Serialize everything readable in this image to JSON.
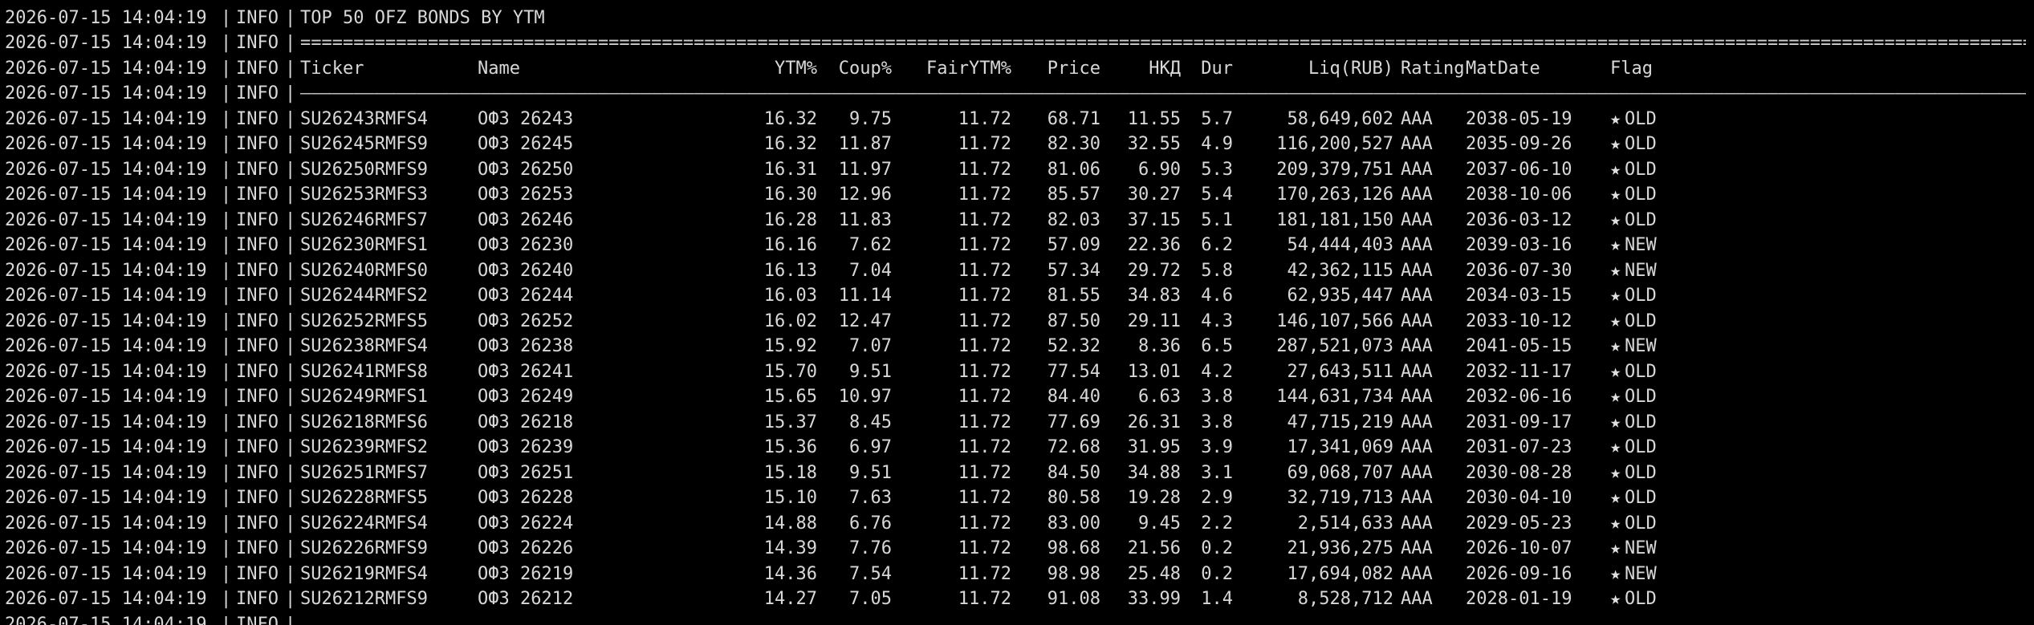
{
  "log": {
    "timestamp": "2026-07-15 14:04:19",
    "level": "INFO",
    "separator": "|",
    "title": "TOP 50 OFZ BONDS BY YTM"
  },
  "table": {
    "headers": {
      "ticker": "Ticker",
      "name": "Name",
      "ytm": "YTM%",
      "coupon": "Coup%",
      "fair_ytm": "FairYTM%",
      "price": "Price",
      "nkd": "НКД",
      "duration": "Dur",
      "liquidity": "Liq(RUB)",
      "rating": "Rating",
      "maturity": "MatDate",
      "flag": "Flag"
    },
    "rows": [
      {
        "ticker": "SU26243RMFS4",
        "name": "ОФЗ 26243",
        "ytm": "16.32",
        "coupon": "9.75",
        "fair_ytm": "11.72",
        "price": "68.71",
        "nkd": "11.55",
        "duration": "5.7",
        "liquidity": "58,649,602",
        "rating": "AAA",
        "maturity": "2038-05-19",
        "flag_icon": "★",
        "flag": "OLD"
      },
      {
        "ticker": "SU26245RMFS9",
        "name": "ОФЗ 26245",
        "ytm": "16.32",
        "coupon": "11.87",
        "fair_ytm": "11.72",
        "price": "82.30",
        "nkd": "32.55",
        "duration": "4.9",
        "liquidity": "116,200,527",
        "rating": "AAA",
        "maturity": "2035-09-26",
        "flag_icon": "★",
        "flag": "OLD"
      },
      {
        "ticker": "SU26250RMFS9",
        "name": "ОФЗ 26250",
        "ytm": "16.31",
        "coupon": "11.97",
        "fair_ytm": "11.72",
        "price": "81.06",
        "nkd": "6.90",
        "duration": "5.3",
        "liquidity": "209,379,751",
        "rating": "AAA",
        "maturity": "2037-06-10",
        "flag_icon": "★",
        "flag": "OLD"
      },
      {
        "ticker": "SU26253RMFS3",
        "name": "ОФЗ 26253",
        "ytm": "16.30",
        "coupon": "12.96",
        "fair_ytm": "11.72",
        "price": "85.57",
        "nkd": "30.27",
        "duration": "5.4",
        "liquidity": "170,263,126",
        "rating": "AAA",
        "maturity": "2038-10-06",
        "flag_icon": "★",
        "flag": "OLD"
      },
      {
        "ticker": "SU26246RMFS7",
        "name": "ОФЗ 26246",
        "ytm": "16.28",
        "coupon": "11.83",
        "fair_ytm": "11.72",
        "price": "82.03",
        "nkd": "37.15",
        "duration": "5.1",
        "liquidity": "181,181,150",
        "rating": "AAA",
        "maturity": "2036-03-12",
        "flag_icon": "★",
        "flag": "OLD"
      },
      {
        "ticker": "SU26230RMFS1",
        "name": "ОФЗ 26230",
        "ytm": "16.16",
        "coupon": "7.62",
        "fair_ytm": "11.72",
        "price": "57.09",
        "nkd": "22.36",
        "duration": "6.2",
        "liquidity": "54,444,403",
        "rating": "AAA",
        "maturity": "2039-03-16",
        "flag_icon": "★",
        "flag": "NEW"
      },
      {
        "ticker": "SU26240RMFS0",
        "name": "ОФЗ 26240",
        "ytm": "16.13",
        "coupon": "7.04",
        "fair_ytm": "11.72",
        "price": "57.34",
        "nkd": "29.72",
        "duration": "5.8",
        "liquidity": "42,362,115",
        "rating": "AAA",
        "maturity": "2036-07-30",
        "flag_icon": "★",
        "flag": "NEW"
      },
      {
        "ticker": "SU26244RMFS2",
        "name": "ОФЗ 26244",
        "ytm": "16.03",
        "coupon": "11.14",
        "fair_ytm": "11.72",
        "price": "81.55",
        "nkd": "34.83",
        "duration": "4.6",
        "liquidity": "62,935,447",
        "rating": "AAA",
        "maturity": "2034-03-15",
        "flag_icon": "★",
        "flag": "OLD"
      },
      {
        "ticker": "SU26252RMFS5",
        "name": "ОФЗ 26252",
        "ytm": "16.02",
        "coupon": "12.47",
        "fair_ytm": "11.72",
        "price": "87.50",
        "nkd": "29.11",
        "duration": "4.3",
        "liquidity": "146,107,566",
        "rating": "AAA",
        "maturity": "2033-10-12",
        "flag_icon": "★",
        "flag": "OLD"
      },
      {
        "ticker": "SU26238RMFS4",
        "name": "ОФЗ 26238",
        "ytm": "15.92",
        "coupon": "7.07",
        "fair_ytm": "11.72",
        "price": "52.32",
        "nkd": "8.36",
        "duration": "6.5",
        "liquidity": "287,521,073",
        "rating": "AAA",
        "maturity": "2041-05-15",
        "flag_icon": "★",
        "flag": "NEW"
      },
      {
        "ticker": "SU26241RMFS8",
        "name": "ОФЗ 26241",
        "ytm": "15.70",
        "coupon": "9.51",
        "fair_ytm": "11.72",
        "price": "77.54",
        "nkd": "13.01",
        "duration": "4.2",
        "liquidity": "27,643,511",
        "rating": "AAA",
        "maturity": "2032-11-17",
        "flag_icon": "★",
        "flag": "OLD"
      },
      {
        "ticker": "SU26249RMFS1",
        "name": "ОФЗ 26249",
        "ytm": "15.65",
        "coupon": "10.97",
        "fair_ytm": "11.72",
        "price": "84.40",
        "nkd": "6.63",
        "duration": "3.8",
        "liquidity": "144,631,734",
        "rating": "AAA",
        "maturity": "2032-06-16",
        "flag_icon": "★",
        "flag": "OLD"
      },
      {
        "ticker": "SU26218RMFS6",
        "name": "ОФЗ 26218",
        "ytm": "15.37",
        "coupon": "8.45",
        "fair_ytm": "11.72",
        "price": "77.69",
        "nkd": "26.31",
        "duration": "3.8",
        "liquidity": "47,715,219",
        "rating": "AAA",
        "maturity": "2031-09-17",
        "flag_icon": "★",
        "flag": "OLD"
      },
      {
        "ticker": "SU26239RMFS2",
        "name": "ОФЗ 26239",
        "ytm": "15.36",
        "coupon": "6.97",
        "fair_ytm": "11.72",
        "price": "72.68",
        "nkd": "31.95",
        "duration": "3.9",
        "liquidity": "17,341,069",
        "rating": "AAA",
        "maturity": "2031-07-23",
        "flag_icon": "★",
        "flag": "OLD"
      },
      {
        "ticker": "SU26251RMFS7",
        "name": "ОФЗ 26251",
        "ytm": "15.18",
        "coupon": "9.51",
        "fair_ytm": "11.72",
        "price": "84.50",
        "nkd": "34.88",
        "duration": "3.1",
        "liquidity": "69,068,707",
        "rating": "AAA",
        "maturity": "2030-08-28",
        "flag_icon": "★",
        "flag": "OLD"
      },
      {
        "ticker": "SU26228RMFS5",
        "name": "ОФЗ 26228",
        "ytm": "15.10",
        "coupon": "7.63",
        "fair_ytm": "11.72",
        "price": "80.58",
        "nkd": "19.28",
        "duration": "2.9",
        "liquidity": "32,719,713",
        "rating": "AAA",
        "maturity": "2030-04-10",
        "flag_icon": "★",
        "flag": "OLD"
      },
      {
        "ticker": "SU26224RMFS4",
        "name": "ОФЗ 26224",
        "ytm": "14.88",
        "coupon": "6.76",
        "fair_ytm": "11.72",
        "price": "83.00",
        "nkd": "9.45",
        "duration": "2.2",
        "liquidity": "2,514,633",
        "rating": "AAA",
        "maturity": "2029-05-23",
        "flag_icon": "★",
        "flag": "OLD"
      },
      {
        "ticker": "SU26226RMFS9",
        "name": "ОФЗ 26226",
        "ytm": "14.39",
        "coupon": "7.76",
        "fair_ytm": "11.72",
        "price": "98.68",
        "nkd": "21.56",
        "duration": "0.2",
        "liquidity": "21,936,275",
        "rating": "AAA",
        "maturity": "2026-10-07",
        "flag_icon": "★",
        "flag": "NEW"
      },
      {
        "ticker": "SU26219RMFS4",
        "name": "ОФЗ 26219",
        "ytm": "14.36",
        "coupon": "7.54",
        "fair_ytm": "11.72",
        "price": "98.98",
        "nkd": "25.48",
        "duration": "0.2",
        "liquidity": "17,694,082",
        "rating": "AAA",
        "maturity": "2026-09-16",
        "flag_icon": "★",
        "flag": "NEW"
      },
      {
        "ticker": "SU26212RMFS9",
        "name": "ОФЗ 26212",
        "ytm": "14.27",
        "coupon": "7.05",
        "fair_ytm": "11.72",
        "price": "91.08",
        "nkd": "33.99",
        "duration": "1.4",
        "liquidity": "8,528,712",
        "rating": "AAA",
        "maturity": "2028-01-19",
        "flag_icon": "★",
        "flag": "OLD"
      }
    ]
  }
}
